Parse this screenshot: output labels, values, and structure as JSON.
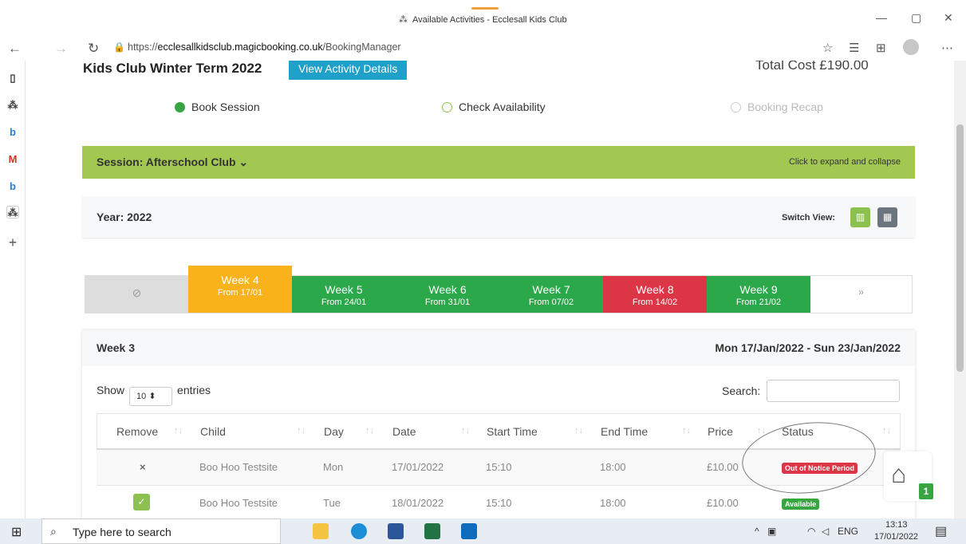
{
  "browser": {
    "tab_title": "Available Activities - Ecclesall Kids Club",
    "url_prefix": "https://",
    "url_host": "ecclesallkidsclub.magicbooking.co.uk",
    "url_path": "/BookingManager"
  },
  "page": {
    "heading": "Kids Club Winter Term 2022",
    "view_details_label": "View Activity Details",
    "total_cost": "Total Cost £190.00",
    "steps": [
      {
        "label": "Book Session",
        "state": "done"
      },
      {
        "label": "Check Availability",
        "state": "current"
      },
      {
        "label": "Booking Recap",
        "state": "pending"
      }
    ],
    "session_label": "Session: Afterschool Club",
    "session_hint": "Click to expand and collapse",
    "year_label": "Year: 2022",
    "switch_view_label": "Switch View:",
    "weeks": [
      {
        "week": "Week 4",
        "from": "From 17/01",
        "color": "#f9b21a"
      },
      {
        "week": "Week 5",
        "from": "From 24/01",
        "color": "#2aa84a"
      },
      {
        "week": "Week 6",
        "from": "From 31/01",
        "color": "#2aa84a"
      },
      {
        "week": "Week 7",
        "from": "From 07/02",
        "color": "#2aa84a"
      },
      {
        "week": "Week 8",
        "from": "From 14/02",
        "color": "#dc3545"
      },
      {
        "week": "Week 9",
        "from": "From 21/02",
        "color": "#2aa84a"
      }
    ],
    "next_label": "»",
    "week_panel": {
      "title": "Week 3",
      "range": "Mon 17/Jan/2022 - Sun 23/Jan/2022",
      "show_label": "Show",
      "entries_value": "10",
      "entries_label": "entries",
      "search_label": "Search:",
      "columns": [
        "Remove",
        "Child",
        "Day",
        "Date",
        "Start Time",
        "End Time",
        "Price",
        "Status"
      ],
      "rows": [
        {
          "remove": "×",
          "child": "Boo Hoo Testsite",
          "day": "Mon",
          "date": "17/01/2022",
          "start": "15:10",
          "end": "18:00",
          "price": "£10.00",
          "status": "Out of Notice Period",
          "status_color": "#dc3545"
        },
        {
          "remove": "✓",
          "child": "Boo Hoo Testsite",
          "day": "Tue",
          "date": "18/01/2022",
          "start": "15:10",
          "end": "18:00",
          "price": "£10.00",
          "status": "Available",
          "status_color": "#37a540"
        }
      ]
    },
    "basket_count": "1"
  },
  "taskbar": {
    "search_placeholder": "Type here to search",
    "lang": "ENG",
    "time": "13:13",
    "date": "17/01/2022"
  }
}
